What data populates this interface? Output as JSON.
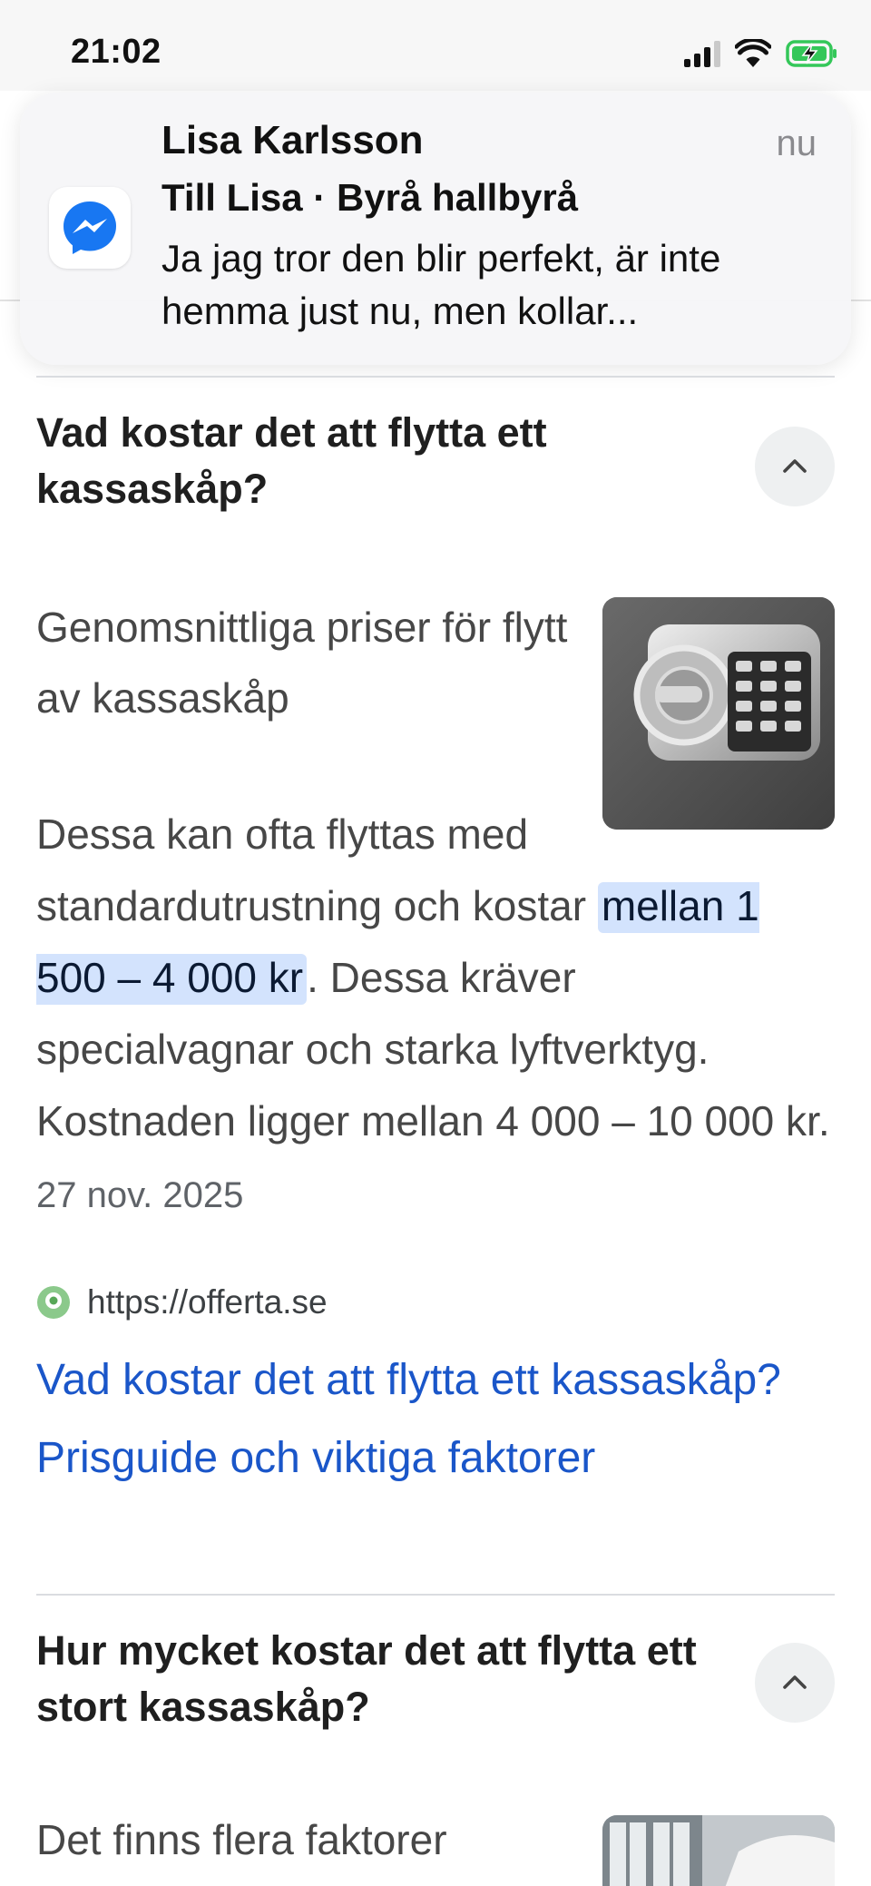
{
  "status_bar": {
    "time": "21:02"
  },
  "notification": {
    "app_icon": "messenger-icon",
    "sender": "Lisa Karlsson",
    "time": "nu",
    "title": "Till Lisa · Byrå hallbyrå",
    "body": "Ja jag tror den blir perfekt, är inte hemma just nu, men kollar..."
  },
  "faq1": {
    "question": "Vad kostar det att flytta ett kassaskåp?",
    "answer_heading": "Genomsnittliga priser för flytt av kassaskåp",
    "answer_before": "Dessa kan ofta flyttas med standardutrustning och kostar ",
    "answer_highlight": "mellan 1 500 – 4 000 kr",
    "answer_after": ". Dessa kräver specialvagnar och starka lyftverktyg. Kostnaden ligger mellan 4 000 – 10 000 kr. ",
    "date": "27 nov. 2025",
    "source_url": "https://offerta.se",
    "link_title": "Vad kostar det att flytta ett kassaskåp? Prisguide och viktiga faktorer"
  },
  "faq2": {
    "question": "Hur mycket kostar det att flytta ett stort kassaskåp?",
    "answer_start": "Det finns flera faktorer"
  },
  "colors": {
    "link": "#1a56c9",
    "highlight": "#d3e3fd",
    "messenger": "#1877f2",
    "battery": "#34c759"
  }
}
